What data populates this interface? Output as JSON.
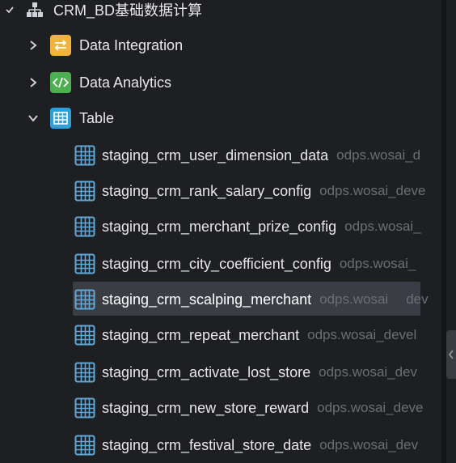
{
  "root": {
    "label": "CRM_BD基础数据计算",
    "icon": "hierarchy-icon",
    "toggle": "check-chevron"
  },
  "folders": [
    {
      "label": "Data Integration",
      "icon": "sync-arrows-icon",
      "color": "#f0b43c",
      "expanded": false
    },
    {
      "label": "Data Analytics",
      "icon": "code-icon",
      "color": "#4caf50",
      "expanded": false
    },
    {
      "label": "Table",
      "icon": "table-icon",
      "color": "#2f9fd8",
      "expanded": true
    }
  ],
  "tables": [
    {
      "name": "staging_crm_user_dimension_data",
      "source": "odps.wosai_d"
    },
    {
      "name": "staging_crm_rank_salary_config",
      "source": "odps.wosai_deve"
    },
    {
      "name": "staging_crm_merchant_prize_config",
      "source": "odps.wosai_"
    },
    {
      "name": "staging_crm_city_coefficient_config",
      "source": "odps.wosai_"
    },
    {
      "name": "staging_crm_scalping_merchant",
      "source": "odps.wosai",
      "source_tail": "dev",
      "selected": true
    },
    {
      "name": "staging_crm_repeat_merchant",
      "source": "odps.wosai_devel"
    },
    {
      "name": "staging_crm_activate_lost_store",
      "source": "odps.wosai_dev"
    },
    {
      "name": "staging_crm_new_store_reward",
      "source": "odps.wosai_deve"
    },
    {
      "name": "staging_crm_festival_store_date",
      "source": "odps.wosai_dev"
    }
  ],
  "colors": {
    "background": "#1e1f22",
    "selection": "#3a3d44",
    "table_icon": "#5fa8d8",
    "muted": "#6c6e73"
  }
}
